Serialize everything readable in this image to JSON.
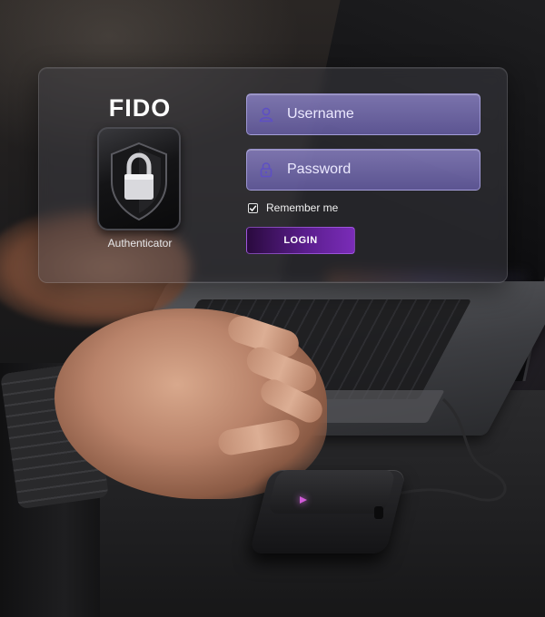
{
  "brand": {
    "title": "FIDO",
    "subtitle": "Authenticator"
  },
  "form": {
    "username_placeholder": "Username",
    "password_placeholder": "Password",
    "remember_label": "Remember me",
    "remember_checked": true,
    "login_label": "LOGIN"
  },
  "icons": {
    "brand": "shield-lock-icon",
    "username": "user-icon",
    "password": "padlock-icon",
    "remember": "checkmark-icon"
  },
  "colors": {
    "field_fill": "#8c82d0",
    "login_accent": "#6a24a4",
    "device_led": "#d05bd6"
  }
}
